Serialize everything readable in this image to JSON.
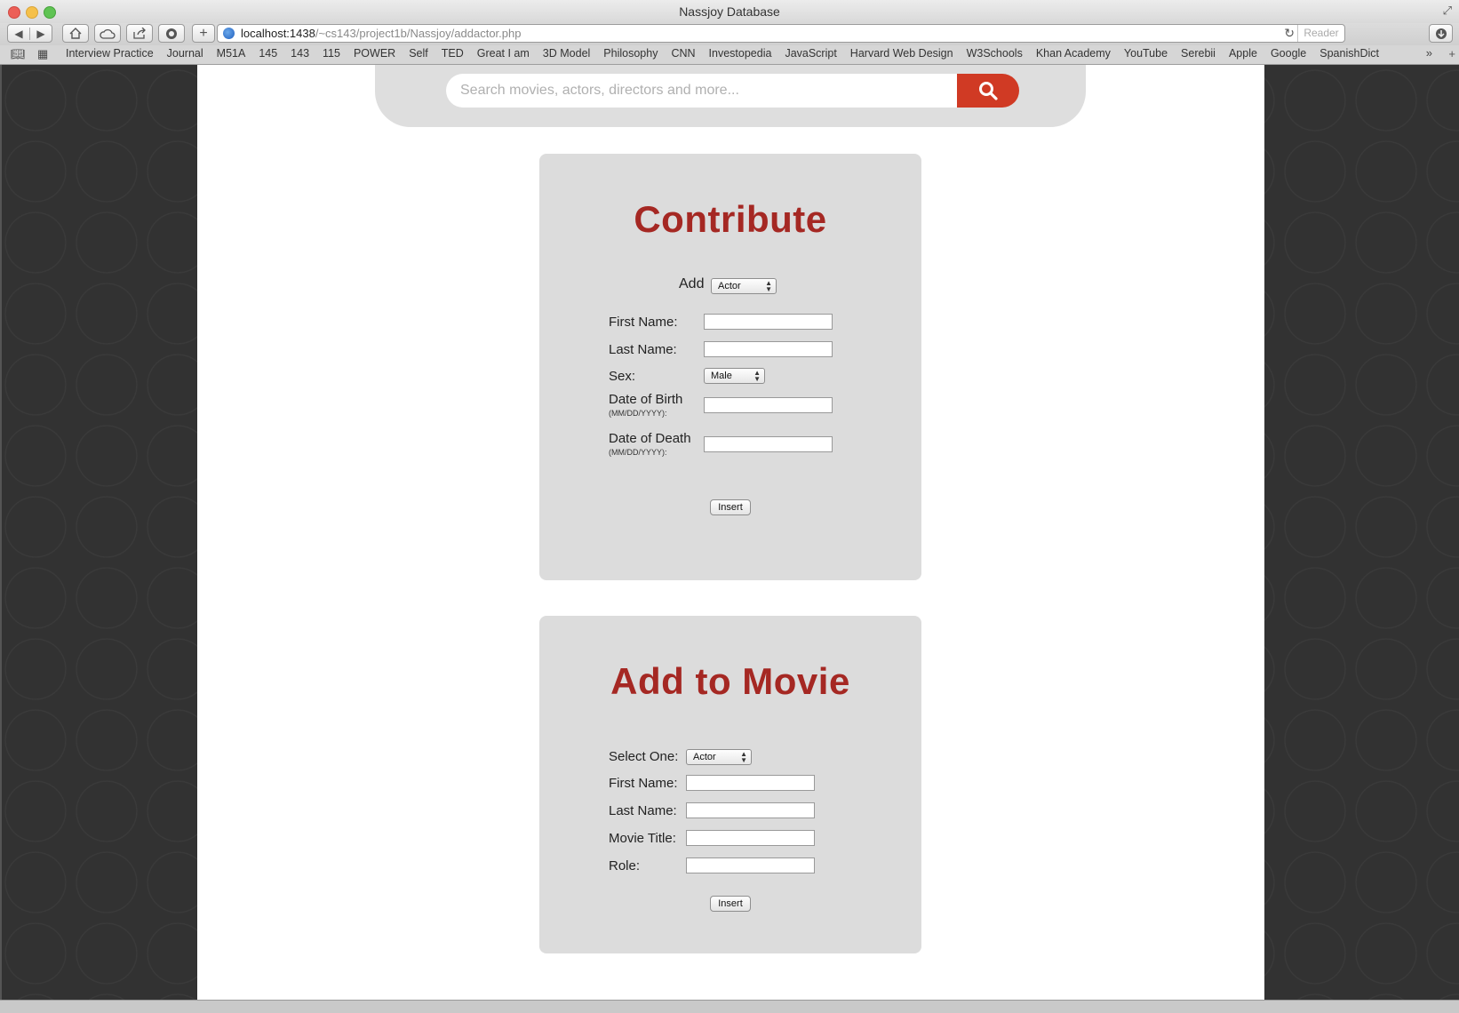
{
  "window": {
    "title": "Nassjoy Database"
  },
  "toolbar": {
    "back_icon": "back-arrow-icon",
    "forward_icon": "forward-arrow-icon",
    "url_host": "localhost:1438",
    "url_path": "/~cs143/project1b/Nassjoy/addactor.php",
    "reader_label": "Reader"
  },
  "bookmarks": [
    "Interview Practice",
    "Journal",
    "M51A",
    "145",
    "143",
    "115",
    "POWER",
    "Self",
    "TED",
    "Great I am",
    "3D Model",
    "Philosophy",
    "CNN",
    "Investopedia",
    "JavaScript",
    "Harvard Web Design",
    "W3Schools",
    "Khan Academy",
    "YouTube",
    "Serebii",
    "Apple",
    "Google",
    "SpanishDict"
  ],
  "search": {
    "placeholder": "Search movies, actors, directors and more..."
  },
  "contribute": {
    "title": "Contribute",
    "add_label": "Add",
    "add_type": "Actor",
    "first_name_label": "First Name:",
    "last_name_label": "Last Name:",
    "sex_label": "Sex:",
    "sex_value": "Male",
    "dob_label": "Date of Birth",
    "dob_hint": "(MM/DD/YYYY):",
    "dod_label": "Date of Death",
    "dod_hint": "(MM/DD/YYYY):",
    "insert_label": "Insert"
  },
  "add_to_movie": {
    "title": "Add to Movie",
    "select_label": "Select One:",
    "select_value": "Actor",
    "first_name_label": "First Name:",
    "last_name_label": "Last Name:",
    "movie_title_label": "Movie Title:",
    "role_label": "Role:",
    "insert_label": "Insert"
  },
  "colors": {
    "accent": "#a52823",
    "search_button": "#d03a24",
    "card_bg": "#dcdcdc"
  }
}
